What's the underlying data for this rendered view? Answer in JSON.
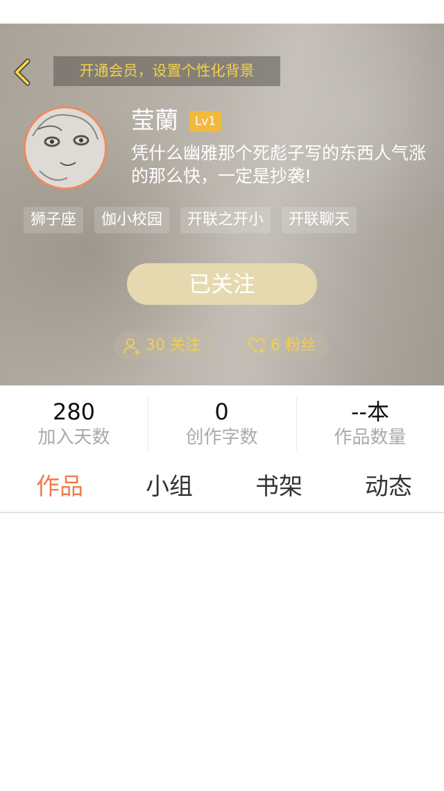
{
  "header": {
    "vip_banner": "开通会员，设置个性化背景",
    "username": "莹蘭",
    "level": "Lv1",
    "bio": "凭什么幽雅那个死彪子写的东西人气涨的那么快，一定是抄袭!",
    "tags": [
      "狮子座",
      "伽小校园",
      "开联之开小",
      "开联聊天"
    ],
    "follow_button": "已关注",
    "following": "30 关注",
    "fans": "6 粉丝"
  },
  "stats": [
    {
      "value": "280",
      "label": "加入天数"
    },
    {
      "value": "0",
      "label": "创作字数"
    },
    {
      "value": "--本",
      "label": "作品数量"
    }
  ],
  "tabs": [
    {
      "label": "作品",
      "active": true
    },
    {
      "label": "小组",
      "active": false
    },
    {
      "label": "书架",
      "active": false
    },
    {
      "label": "动态",
      "active": false
    }
  ],
  "icons": {
    "back": "chevron-left-icon",
    "following": "user-plus-icon",
    "fans": "heart-plus-icon"
  },
  "colors": {
    "accent": "#ef7e4a",
    "gold": "#f3d24a",
    "level_badge": "#f2b93d",
    "follow_button": "#e6d9b0"
  }
}
